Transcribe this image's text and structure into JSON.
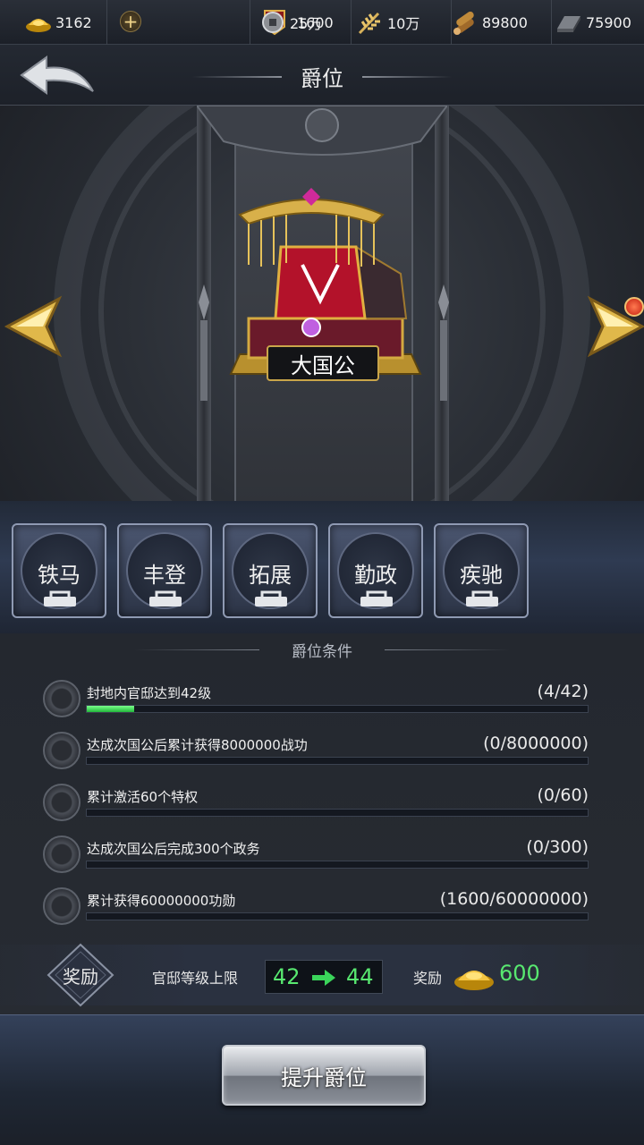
{
  "resources": [
    {
      "icon": "gold-ingot-icon",
      "value": "3162"
    },
    {
      "icon": "merit-badge-icon",
      "value": "1600"
    },
    {
      "icon": "copper-coin-icon",
      "value": "25万"
    },
    {
      "icon": "grain-icon",
      "value": "10万"
    },
    {
      "icon": "wood-icon",
      "value": "89800"
    },
    {
      "icon": "iron-icon",
      "value": "75900"
    }
  ],
  "resource_add_label": "+",
  "header": {
    "title": "爵位"
  },
  "rank": {
    "name": "大国公"
  },
  "privileges": [
    {
      "label": "铁马",
      "locked": true
    },
    {
      "label": "丰登",
      "locked": true
    },
    {
      "label": "拓展",
      "locked": true
    },
    {
      "label": "勤政",
      "locked": true
    },
    {
      "label": "疾驰",
      "locked": true
    }
  ],
  "conditions_title": "爵位条件",
  "conditions": [
    {
      "text": "封地内官邸达到42级",
      "progress": "(4/42)",
      "fraction": 0.0952
    },
    {
      "text": "达成次国公后累计获得8000000战功",
      "progress": "(0/8000000)",
      "fraction": 0
    },
    {
      "text": "累计激活60个特权",
      "progress": "(0/60)",
      "fraction": 0
    },
    {
      "text": "达成次国公后完成300个政务",
      "progress": "(0/300)",
      "fraction": 0
    },
    {
      "text": "累计获得60000000功勋",
      "progress": "(1600/60000000)",
      "fraction": 2.67e-05
    }
  ],
  "reward": {
    "badge_label": "奖励",
    "level_label": "官邸等级上限",
    "level_from": "42",
    "level_to": "44",
    "reward_label": "奖励",
    "reward_amount": "600"
  },
  "button": {
    "promote_label": "提升爵位"
  },
  "colors": {
    "progress": "#22b83a",
    "reward_value": "#58e870",
    "gold": "#c9a54a"
  }
}
